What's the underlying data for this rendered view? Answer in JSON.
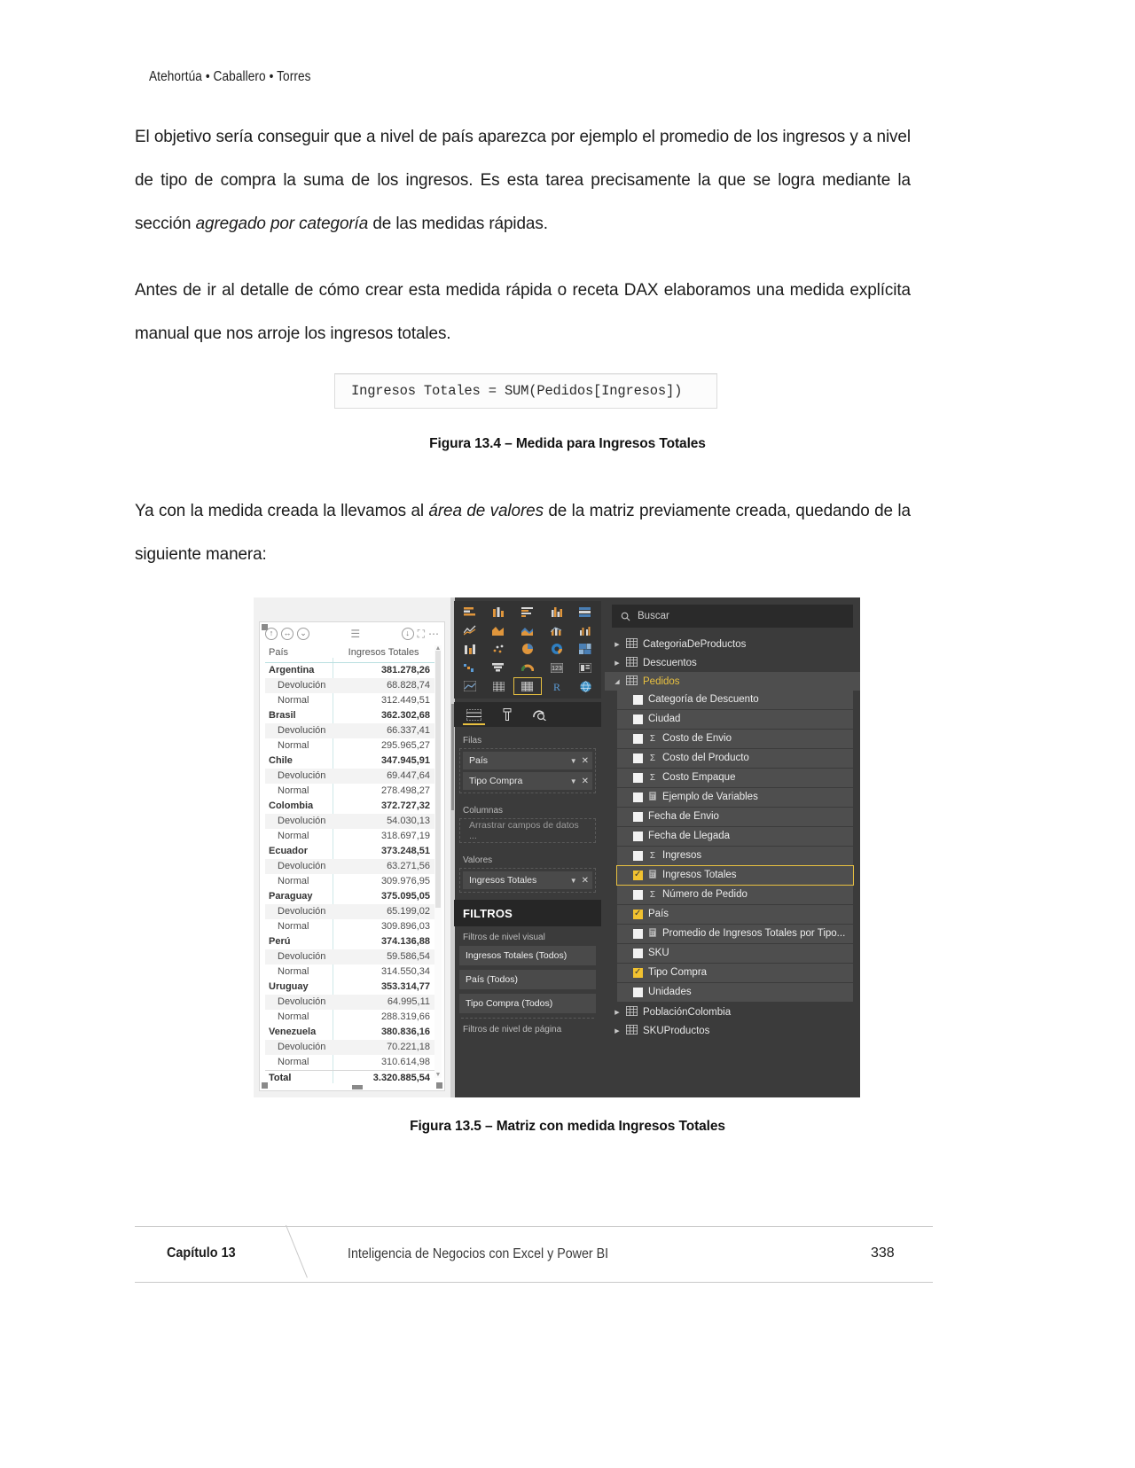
{
  "running_head": "Atehortúa • Caballero • Torres",
  "paragraphs": [
    "El objetivo sería conseguir que a nivel de país aparezca por ejemplo el promedio de los ingresos y a nivel de tipo de compra la suma de los ingresos. Es esta tarea precisamente la que se logra mediante la sección ",
    "Antes de ir al detalle de cómo crear esta medida rápida o receta DAX elaboramos una medida explícita manual que nos arroje los ingresos totales.",
    "Ya con la medida creada la llevamos al ",
    " de la matriz previamente creada, quedando de la siguiente manera:"
  ],
  "para1_italic": "agregado por categoría",
  "para1_tail": " de las medidas rápidas.",
  "para3_italic": "área de valores",
  "formula": {
    "prefix": "Ingresos Totales = ",
    "fn": "SUM",
    "suffix": "(Pedidos[Ingresos])"
  },
  "captions": {
    "fig_13_4": "Figura 13.4 – Medida para Ingresos Totales",
    "fig_13_5": "Figura 13.5 – Matriz con medida Ingresos Totales"
  },
  "matrix": {
    "columns": [
      "País",
      "Ingresos Totales"
    ],
    "rows": [
      {
        "label": "Argentina",
        "value": "381.278,26",
        "level": 0
      },
      {
        "label": "Devolución",
        "value": "68.828,74",
        "level": 1
      },
      {
        "label": "Normal",
        "value": "312.449,51",
        "level": 1
      },
      {
        "label": "Brasil",
        "value": "362.302,68",
        "level": 0
      },
      {
        "label": "Devolución",
        "value": "66.337,41",
        "level": 1
      },
      {
        "label": "Normal",
        "value": "295.965,27",
        "level": 1
      },
      {
        "label": "Chile",
        "value": "347.945,91",
        "level": 0
      },
      {
        "label": "Devolución",
        "value": "69.447,64",
        "level": 1
      },
      {
        "label": "Normal",
        "value": "278.498,27",
        "level": 1
      },
      {
        "label": "Colombia",
        "value": "372.727,32",
        "level": 0
      },
      {
        "label": "Devolución",
        "value": "54.030,13",
        "level": 1
      },
      {
        "label": "Normal",
        "value": "318.697,19",
        "level": 1
      },
      {
        "label": "Ecuador",
        "value": "373.248,51",
        "level": 0
      },
      {
        "label": "Devolución",
        "value": "63.271,56",
        "level": 1
      },
      {
        "label": "Normal",
        "value": "309.976,95",
        "level": 1
      },
      {
        "label": "Paraguay",
        "value": "375.095,05",
        "level": 0
      },
      {
        "label": "Devolución",
        "value": "65.199,02",
        "level": 1
      },
      {
        "label": "Normal",
        "value": "309.896,03",
        "level": 1
      },
      {
        "label": "Perú",
        "value": "374.136,88",
        "level": 0
      },
      {
        "label": "Devolución",
        "value": "59.586,54",
        "level": 1
      },
      {
        "label": "Normal",
        "value": "314.550,34",
        "level": 1
      },
      {
        "label": "Uruguay",
        "value": "353.314,77",
        "level": 0
      },
      {
        "label": "Devolución",
        "value": "64.995,11",
        "level": 1
      },
      {
        "label": "Normal",
        "value": "288.319,66",
        "level": 1
      },
      {
        "label": "Venezuela",
        "value": "380.836,16",
        "level": 0
      },
      {
        "label": "Devolución",
        "value": "70.221,18",
        "level": 1
      },
      {
        "label": "Normal",
        "value": "310.614,98",
        "level": 1
      }
    ],
    "total": {
      "label": "Total",
      "value": "3.320.885,54"
    }
  },
  "viz_pane": {
    "gallery_icons": [
      "stacked-bar-chart-icon",
      "stacked-column-chart-icon",
      "clustered-bar-chart-icon",
      "clustered-column-chart-icon",
      "100-stacked-bar-chart-icon",
      "line-chart-icon",
      "area-chart-icon",
      "stacked-area-chart-icon",
      "line-stacked-column-icon",
      "line-clustered-column-icon",
      "ribbon-chart-icon",
      "scatter-chart-icon",
      "pie-chart-icon",
      "donut-chart-icon",
      "treemap-icon",
      "waterfall-chart-icon",
      "funnel-chart-icon",
      "gauge-icon",
      "card-icon",
      "multi-row-card-icon",
      "kpi-icon",
      "table-icon",
      "matrix-icon",
      "r-script-visual-icon",
      "map-icon",
      "more-options-icon"
    ],
    "selected_icon": "matrix-icon",
    "tabs": [
      "fields-tab-icon",
      "format-paintbrush-icon",
      "analytics-magnifier-icon"
    ],
    "active_tab": "fields-tab-icon",
    "wells": [
      {
        "label": "Filas",
        "items": [
          "País",
          "Tipo Compra"
        ],
        "placeholder": null
      },
      {
        "label": "Columnas",
        "items": [],
        "placeholder": "Arrastrar campos de datos ..."
      },
      {
        "label": "Valores",
        "items": [
          "Ingresos Totales"
        ],
        "placeholder": null
      }
    ],
    "filters_title": "FILTROS",
    "filter_sections": [
      {
        "label": "Filtros de nivel visual",
        "items": [
          "Ingresos Totales  (Todos)",
          "País  (Todos)",
          "Tipo Compra  (Todos)"
        ]
      },
      {
        "label": "Filtros de nivel de página",
        "items": []
      }
    ]
  },
  "fields_pane": {
    "search_placeholder": "Buscar",
    "tables": [
      {
        "name": "CategoriaDeProductos",
        "expanded": false,
        "fields": []
      },
      {
        "name": "Descuentos",
        "expanded": false,
        "fields": []
      },
      {
        "name": "Pedidos",
        "expanded": true,
        "fields": [
          {
            "name": "Categoría de Descuento",
            "checked": false,
            "marker": "",
            "highlight": false
          },
          {
            "name": "Ciudad",
            "checked": false,
            "marker": "",
            "highlight": false
          },
          {
            "name": "Costo de Envio",
            "checked": false,
            "marker": "sigma",
            "highlight": false
          },
          {
            "name": "Costo del Producto",
            "checked": false,
            "marker": "sigma",
            "highlight": false
          },
          {
            "name": "Costo Empaque",
            "checked": false,
            "marker": "sigma",
            "highlight": false
          },
          {
            "name": "Ejemplo de Variables",
            "checked": false,
            "marker": "calc",
            "highlight": false
          },
          {
            "name": "Fecha de Envio",
            "checked": false,
            "marker": "",
            "highlight": false
          },
          {
            "name": "Fecha de Llegada",
            "checked": false,
            "marker": "",
            "highlight": false
          },
          {
            "name": "Ingresos",
            "checked": false,
            "marker": "sigma",
            "highlight": false
          },
          {
            "name": "Ingresos Totales",
            "checked": true,
            "marker": "calc",
            "highlight": true
          },
          {
            "name": "Número de Pedido",
            "checked": false,
            "marker": "sigma",
            "highlight": false
          },
          {
            "name": "País",
            "checked": true,
            "marker": "",
            "highlight": false
          },
          {
            "name": "Promedio de Ingresos Totales por Tipo...",
            "checked": false,
            "marker": "calc",
            "highlight": false
          },
          {
            "name": "SKU",
            "checked": false,
            "marker": "",
            "highlight": false
          },
          {
            "name": "Tipo Compra",
            "checked": true,
            "marker": "",
            "highlight": false
          },
          {
            "name": "Unidades",
            "checked": false,
            "marker": "",
            "highlight": false
          }
        ]
      },
      {
        "name": "PoblaciónColombia",
        "expanded": false,
        "fields": []
      },
      {
        "name": "SKUProductos",
        "expanded": false,
        "fields": []
      }
    ]
  },
  "footer": {
    "chapter": "Capítulo 13",
    "title": "Inteligencia de Negocios con Excel y Power BI",
    "page": "338"
  }
}
